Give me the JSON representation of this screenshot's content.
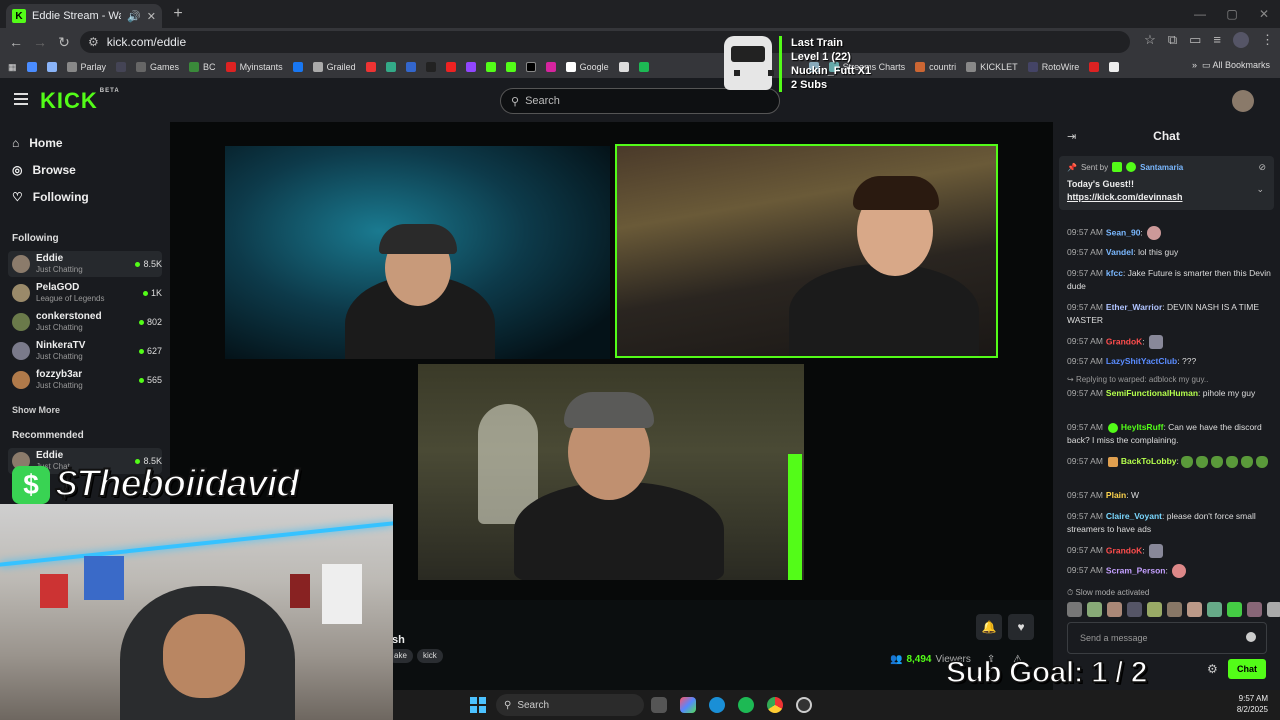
{
  "browser": {
    "tab_title": "Eddie Stream - Watch Live ...",
    "url": "kick.com/eddie",
    "bookmarks": [
      "Parlay",
      "Games",
      "BC",
      "Myinstants",
      "Grailed",
      "Google",
      "Streams Charts",
      "countri",
      "KICKLET",
      "RotoWire"
    ],
    "all_bookmarks": "All Bookmarks"
  },
  "header": {
    "logo": "KICK",
    "beta": "BETA",
    "search_placeholder": "Search"
  },
  "sidebar": {
    "nav": [
      {
        "label": "Home",
        "icon": "home-icon"
      },
      {
        "label": "Browse",
        "icon": "compass-icon"
      },
      {
        "label": "Following",
        "icon": "heart-icon"
      }
    ],
    "following_label": "Following",
    "following": [
      {
        "name": "Eddie",
        "category": "Just Chatting",
        "viewers": "8.5K"
      },
      {
        "name": "PelaGOD",
        "category": "League of Legends",
        "viewers": "1K"
      },
      {
        "name": "conkerstoned",
        "category": "Just Chatting",
        "viewers": "802"
      },
      {
        "name": "NinkeraTV",
        "category": "Just Chatting",
        "viewers": "627"
      },
      {
        "name": "fozzyb3ar",
        "category": "Just Chatting",
        "viewers": "565"
      }
    ],
    "show_more": "Show More",
    "recommended_label": "Recommended",
    "recommended": [
      {
        "name": "Eddie",
        "category": "Just Chat",
        "viewers": "8.5K"
      }
    ]
  },
  "stream": {
    "title_fragment": "sh",
    "tags": [
      "ake",
      "kick"
    ],
    "viewers_count": "8,494",
    "viewers_label": "Viewers"
  },
  "chat": {
    "title": "Chat",
    "pinned": {
      "sent_by": "Sent by",
      "sender": "Santamaria",
      "text": "Today's Guest!!",
      "link": "https://kick.com/devinnash"
    },
    "messages": [
      {
        "time": "09:57 AM",
        "user": "Sean_90",
        "color": "#7ab8ff",
        "text": ""
      },
      {
        "time": "09:57 AM",
        "user": "Vandel",
        "color": "#7ab8ff",
        "text": "lol this guy"
      },
      {
        "time": "09:57 AM",
        "user": "kfcc",
        "color": "#7ab8ff",
        "text": "Jake Future is smarter then this Devin dude"
      },
      {
        "time": "09:57 AM",
        "user": "Ether_Warrior",
        "color": "#b0c4ff",
        "text": "DEVIN NASH IS A TIME WASTER"
      },
      {
        "time": "09:57 AM",
        "user": "GrandoK",
        "color": "#ff4d4d",
        "text": ""
      },
      {
        "time": "09:57 AM",
        "user": "LazyShitYactClub",
        "color": "#5a8cff",
        "text": "???"
      },
      {
        "time": "09:57 AM",
        "user": "SemiFunctionalHuman",
        "color": "#b5ff4d",
        "text": "pihole my guy"
      },
      {
        "time": "09:57 AM",
        "user": "HeyItsRuff",
        "color": "#53fc18",
        "text": "Can we have the discord back? I miss the complaining."
      },
      {
        "time": "09:57 AM",
        "user": "BackToLobby",
        "color": "#b5ff4d",
        "text": ""
      },
      {
        "time": "09:57 AM",
        "user": "Plain",
        "color": "#ffd54d",
        "text": "W"
      },
      {
        "time": "09:57 AM",
        "user": "Claire_Voyant",
        "color": "#7ad8ff",
        "text": "please don't force small streamers to have ads"
      },
      {
        "time": "09:57 AM",
        "user": "GrandoK",
        "color": "#ff4d4d",
        "text": ""
      },
      {
        "time": "09:57 AM",
        "user": "Scram_Person",
        "color": "#c4a0ff",
        "text": ""
      }
    ],
    "reply_text": "Replying to warped: adblock my guy..",
    "slow_mode": "Slow mode activated",
    "input_placeholder": "Send a message",
    "send_label": "Chat"
  },
  "overlays": {
    "donor": "$Theboiidavid",
    "last_train": {
      "title": "Last Train",
      "level": "Level 1",
      "level_count": "(22)",
      "user": "Nuckin_Futt X1",
      "subs": "2 Subs"
    },
    "sub_goal": "Sub Goal: 1 / 2"
  },
  "taskbar": {
    "search": "Search",
    "time": "9:57 AM",
    "date": "8/2/2025"
  },
  "colors": {
    "kick_green": "#53fc18",
    "background": "#0b0e0f",
    "panel": "#191b1f"
  }
}
